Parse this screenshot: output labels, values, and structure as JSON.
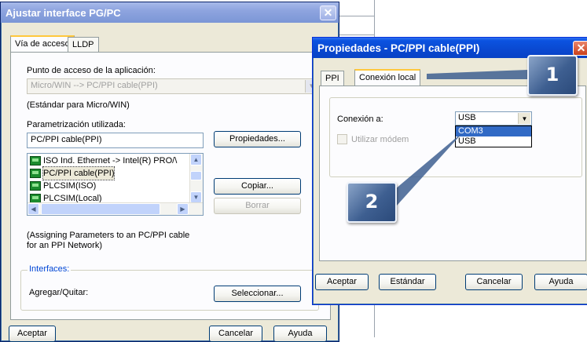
{
  "window_main": {
    "title": "Ajustar interface PG/PC",
    "tabs": [
      "Vía de acceso",
      "LLDP"
    ],
    "access_point_label": "Punto de acceso de la aplicación:",
    "access_point_value": "Micro/WIN     --> PC/PPI cable(PPI)",
    "access_point_note": "(Estándar para Micro/WIN)",
    "param_label": "Parametrización utilizada:",
    "param_value": "PC/PPI cable(PPI)",
    "properties_button": "Propiedades...",
    "list_items": [
      "ISO Ind. Ethernet -> Intel(R) PRO/\\",
      "PC/PPI cable(PPI)",
      "PLCSIM(ISO)",
      "PLCSIM(Local)"
    ],
    "copy_button": "Copiar...",
    "delete_button": "Borrar",
    "description": "(Assigning Parameters to an PC/PPI cable",
    "description2": "for an PPI Network)",
    "interfaces_group": "Interfaces:",
    "add_remove_label": "Agregar/Quitar:",
    "select_button": "Seleccionar...",
    "ok_button": "Aceptar",
    "cancel_button": "Cancelar",
    "help_button": "Ayuda"
  },
  "window_props": {
    "title": "Propiedades - PC/PPI cable(PPI)",
    "tabs": [
      "PPI",
      "Conexión local"
    ],
    "connection_label": "Conexión a:",
    "connection_value": "USB",
    "dropdown_options": [
      "COM3",
      "USB"
    ],
    "modem_checkbox": "Utilizar módem",
    "ok_button": "Aceptar",
    "default_button": "Estándar",
    "cancel_button": "Cancelar",
    "help_button": "Ayuda"
  },
  "callouts": [
    "1",
    "2"
  ],
  "icons": {
    "close": "close-icon",
    "dropdown": "chevron-down-icon",
    "device": "network-card-icon"
  },
  "colors": {
    "active_title": "#0842c6",
    "inactive_title": "#8ea4df",
    "dialog_bg": "#ece9d8",
    "callout": "#3e5f91",
    "selection": "#316ac5"
  }
}
